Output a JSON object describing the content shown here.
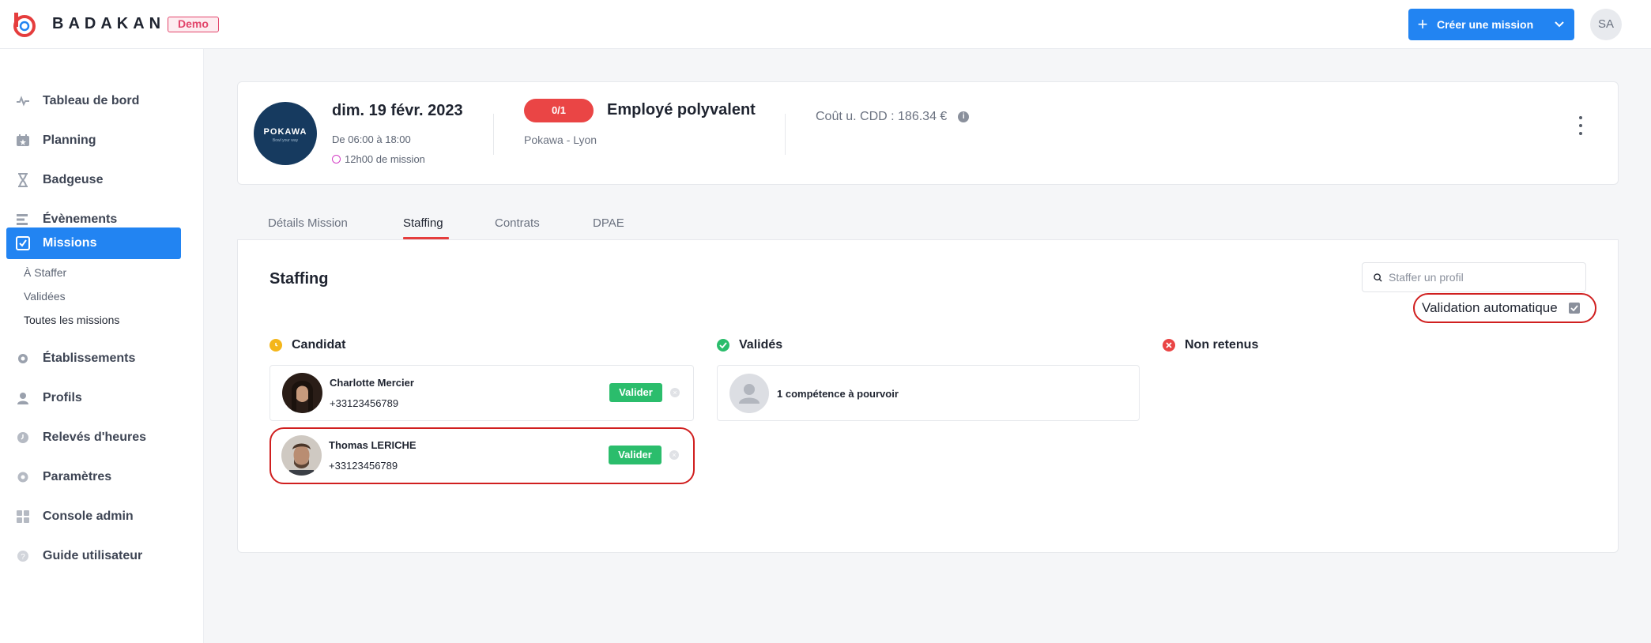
{
  "header": {
    "brand": "BADAKAN",
    "env_badge": "Demo",
    "create_button": "Créer une mission",
    "user_initials": "SA"
  },
  "sidebar": {
    "items": [
      {
        "label": "Tableau de bord",
        "icon": "pulse-icon"
      },
      {
        "label": "Planning",
        "icon": "calendar-icon"
      },
      {
        "label": "Badgeuse",
        "icon": "hourglass-icon"
      },
      {
        "label": "Évènements",
        "icon": "events-icon"
      },
      {
        "label": "Missions",
        "icon": "mission-check-icon",
        "active": true
      },
      {
        "label": "Établissements",
        "icon": "building-icon"
      },
      {
        "label": "Profils",
        "icon": "user-icon"
      },
      {
        "label": "Relevés d'heures",
        "icon": "clock-icon"
      },
      {
        "label": "Paramètres",
        "icon": "gear-icon"
      },
      {
        "label": "Console admin",
        "icon": "grid-icon"
      },
      {
        "label": "Guide utilisateur",
        "icon": "help-icon"
      }
    ],
    "mission_subitems": [
      "À Staffer",
      "Validées",
      "Toutes les missions"
    ]
  },
  "mission": {
    "client_logo_text": "POKAWA",
    "client_logo_sub": "Bowl your way",
    "date": "dim. 19 févr. 2023",
    "hours": "De 06:00 à 18:00",
    "duration": "12h00 de mission",
    "staffing_count": "0/1",
    "role": "Employé polyvalent",
    "location": "Pokawa - Lyon",
    "cost": "Coût u. CDD : 186.34 €"
  },
  "tabs": [
    {
      "label": "Détails Mission"
    },
    {
      "label": "Staffing",
      "active": true
    },
    {
      "label": "Contrats"
    },
    {
      "label": "DPAE"
    }
  ],
  "staffing": {
    "title": "Staffing",
    "search_placeholder": "Staffer un profil",
    "auto_validation_label": "Validation automatique",
    "auto_validation_checked": true,
    "columns": {
      "candidat": "Candidat",
      "valides": "Validés",
      "non_retenus": "Non retenus"
    },
    "candidates": [
      {
        "name": "Charlotte Mercier",
        "phone": "+33123456789",
        "action": "Valider"
      },
      {
        "name": "Thomas LERICHE",
        "phone": "+33123456789",
        "action": "Valider"
      }
    ],
    "open_slot": "1 compétence à pourvoir"
  },
  "colors": {
    "accent": "#2284f2",
    "danger": "#ea4545",
    "success": "#2bbd6c",
    "pending": "#f4b61a"
  }
}
